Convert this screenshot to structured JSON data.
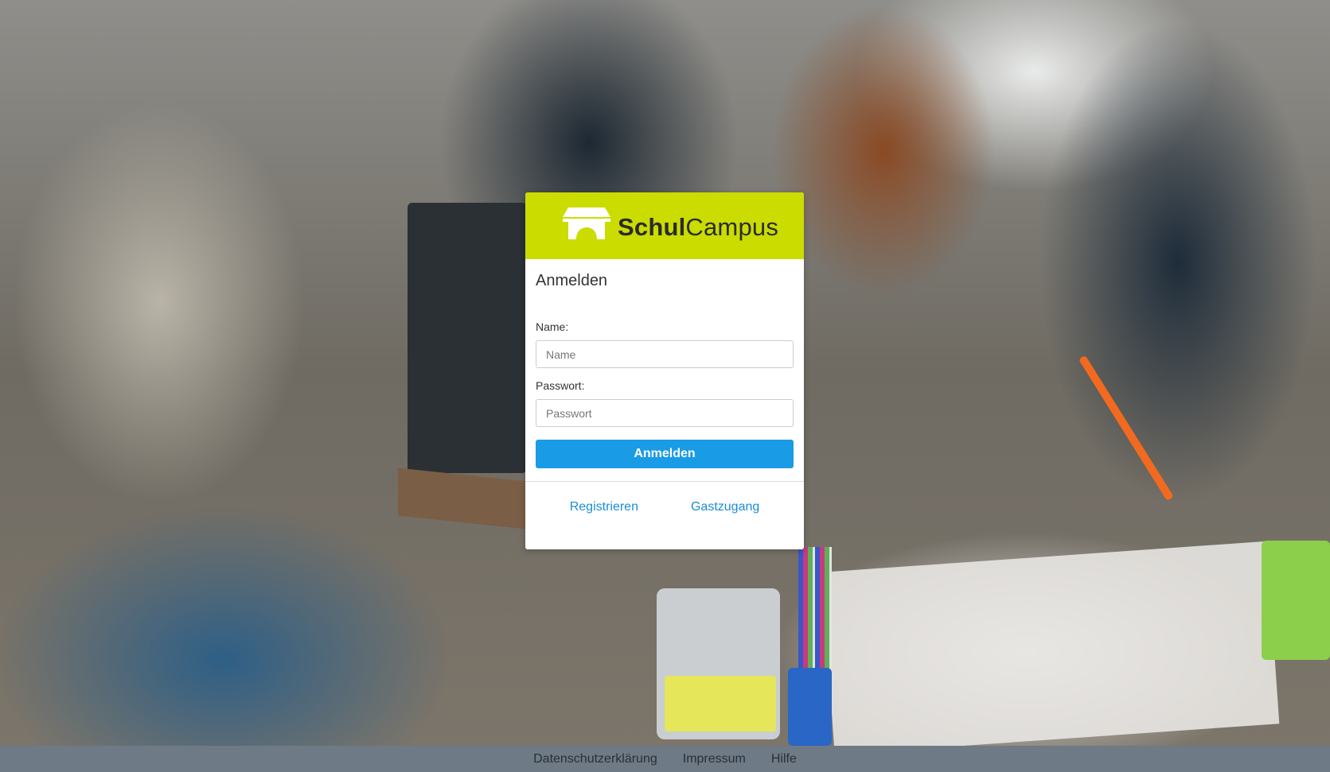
{
  "brand": {
    "name_bold": "Schul",
    "name_light": "Campus",
    "color": "#cadc00"
  },
  "login": {
    "title": "Anmelden",
    "name_label": "Name:",
    "name_placeholder": "Name",
    "name_value": "",
    "password_label": "Passwort:",
    "password_placeholder": "Passwort",
    "password_value": "",
    "submit_label": "Anmelden",
    "submit_color": "#1a9be6"
  },
  "links": {
    "register": "Registrieren",
    "guest": "Gastzugang"
  },
  "footer": {
    "items": [
      "Datenschutzerklärung",
      "Impressum",
      "Hilfe"
    ],
    "background": "#6e7a85"
  },
  "background": {
    "description_icon": "classroom-photo"
  }
}
